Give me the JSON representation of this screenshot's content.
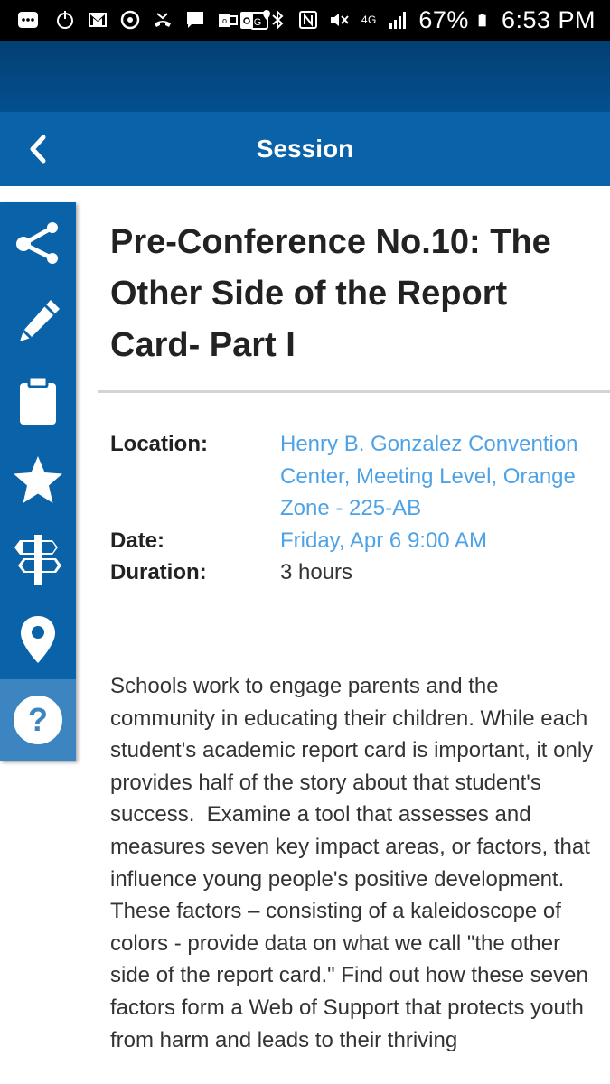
{
  "status_bar": {
    "battery_percent": "67%",
    "time": "6:53 PM",
    "network": "4G",
    "left_icons": [
      "more-icon",
      "power-icon",
      "gmail-icon",
      "sync-icon",
      "missed-call-icon",
      "message-icon",
      "outlook-icon",
      "maps-icon"
    ],
    "right_icons": [
      "recycle-icon",
      "bluetooth-icon",
      "nfc-icon",
      "mute-icon",
      "4g-icon",
      "signal-icon",
      "battery-icon"
    ]
  },
  "app_bar": {
    "title": "Session",
    "back_icon": "chevron-left-icon"
  },
  "sidebar": {
    "items": [
      {
        "name": "share",
        "icon": "share-icon"
      },
      {
        "name": "notes",
        "icon": "pencil-icon"
      },
      {
        "name": "clipboard",
        "icon": "clipboard-icon"
      },
      {
        "name": "favorite",
        "icon": "star-icon"
      },
      {
        "name": "signpost",
        "icon": "signpost-icon"
      },
      {
        "name": "location",
        "icon": "map-pin-icon"
      },
      {
        "name": "help",
        "icon": "help-icon"
      }
    ]
  },
  "session": {
    "title": "Pre-Conference No.10: The Other Side of the Report Card- Part I",
    "location_label": "Location:",
    "location_value": "Henry B. Gonzalez Convention Center, Meeting Level, Orange Zone - 225-AB",
    "date_label": "Date:",
    "date_value": "Friday, Apr 6 9:00 AM",
    "duration_label": "Duration:",
    "duration_value": "3 hours",
    "description": "Schools work to engage parents and the community in educating their children. While each student's academic report card is important, it only provides half of the story about that student's success.  Examine a tool that assesses and measures seven key impact areas, or factors, that influence young people's positive development.  These factors – consisting of a kaleidoscope of colors - provide data on what we call \"the other side of the report card.\" Find out how these seven factors form a Web of Support that protects youth from harm and leads to their thriving"
  },
  "colors": {
    "app_bar": "#0a62a8",
    "top_band": "#03467f",
    "link": "#4ea2e6",
    "help_item": "#3d85c0"
  }
}
